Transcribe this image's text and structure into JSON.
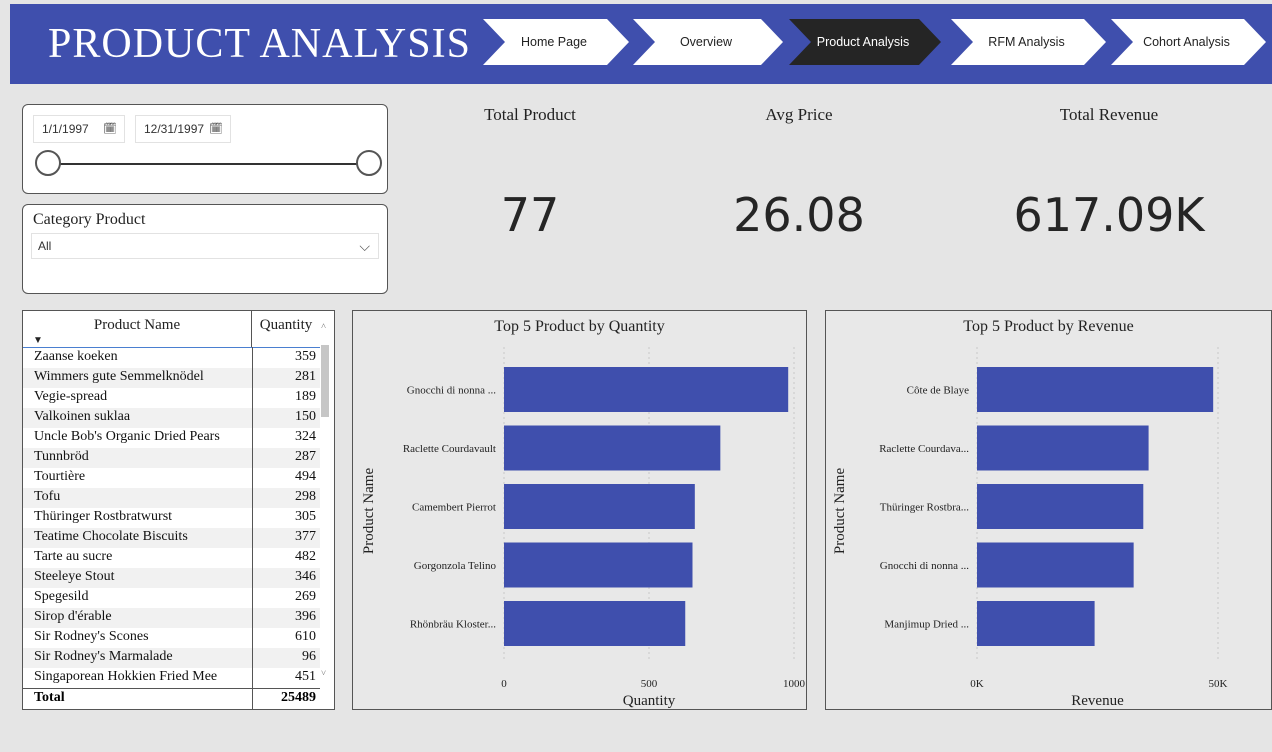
{
  "header": {
    "title": "PRODUCT ANALYSIS",
    "nav": [
      "Home Page",
      "Overview",
      "Product Analysis",
      "RFM Analysis",
      "Cohort Analysis"
    ],
    "active_nav": "Product Analysis"
  },
  "colors": {
    "header_bg": "#3f4fad",
    "bar": "#3f4fad",
    "active_nav": "#252525",
    "nav_bg": "#ffffff"
  },
  "date_filter": {
    "start": "1/1/1997",
    "end": "12/31/1997",
    "calendar_icon": "calendar-icon"
  },
  "category_filter": {
    "label": "Category Product",
    "selected": "All"
  },
  "kpis": {
    "total_product": {
      "label": "Total Product",
      "value": "77"
    },
    "avg_price": {
      "label": "Avg Price",
      "value": "26.08"
    },
    "total_revenue": {
      "label": "Total Revenue",
      "value": "617.09K"
    }
  },
  "table": {
    "headers": [
      "Product Name",
      "Quantity"
    ],
    "rows": [
      {
        "name": "Zaanse koeken",
        "qty": "359"
      },
      {
        "name": "Wimmers gute Semmelknödel",
        "qty": "281"
      },
      {
        "name": "Vegie-spread",
        "qty": "189"
      },
      {
        "name": "Valkoinen suklaa",
        "qty": "150"
      },
      {
        "name": "Uncle Bob's Organic Dried Pears",
        "qty": "324"
      },
      {
        "name": "Tunnbröd",
        "qty": "287"
      },
      {
        "name": "Tourtière",
        "qty": "494"
      },
      {
        "name": "Tofu",
        "qty": "298"
      },
      {
        "name": "Thüringer Rostbratwurst",
        "qty": "305"
      },
      {
        "name": "Teatime Chocolate Biscuits",
        "qty": "377"
      },
      {
        "name": "Tarte au sucre",
        "qty": "482"
      },
      {
        "name": "Steeleye Stout",
        "qty": "346"
      },
      {
        "name": "Spegesild",
        "qty": "269"
      },
      {
        "name": "Sirop d'érable",
        "qty": "396"
      },
      {
        "name": "Sir Rodney's Scones",
        "qty": "610"
      },
      {
        "name": "Sir Rodney's Marmalade",
        "qty": "96"
      },
      {
        "name": "Singaporean Hokkien Fried Mee",
        "qty": "451"
      }
    ],
    "total_label": "Total",
    "total_value": "25489"
  },
  "chart_data": [
    {
      "type": "bar",
      "orientation": "horizontal",
      "title": "Top 5 Product by Quantity",
      "xlabel": "Quantity",
      "ylabel": "Product Name",
      "categories": [
        "Gnocchi di nonna ...",
        "Raclette Courdavault",
        "Camembert Pierrot",
        "Gorgonzola Telino",
        "Rhönbräu Kloster..."
      ],
      "values": [
        980,
        746,
        658,
        650,
        625
      ],
      "xlim": [
        0,
        1000
      ],
      "xticks": [
        "0",
        "500",
        "1000"
      ],
      "grid": true
    },
    {
      "type": "bar",
      "orientation": "horizontal",
      "title": "Top 5 Product by Revenue",
      "xlabel": "Revenue",
      "ylabel": "Product Name",
      "categories": [
        "Côte de Blaye",
        "Raclette Courdava...",
        "Thüringer Rostbra...",
        "Gnocchi di nonna ...",
        "Manjimup Dried ..."
      ],
      "values": [
        49000,
        35600,
        34500,
        32500,
        24400
      ],
      "xlim": [
        0,
        50000
      ],
      "xticks": [
        "0K",
        "50K"
      ],
      "grid": true
    }
  ]
}
